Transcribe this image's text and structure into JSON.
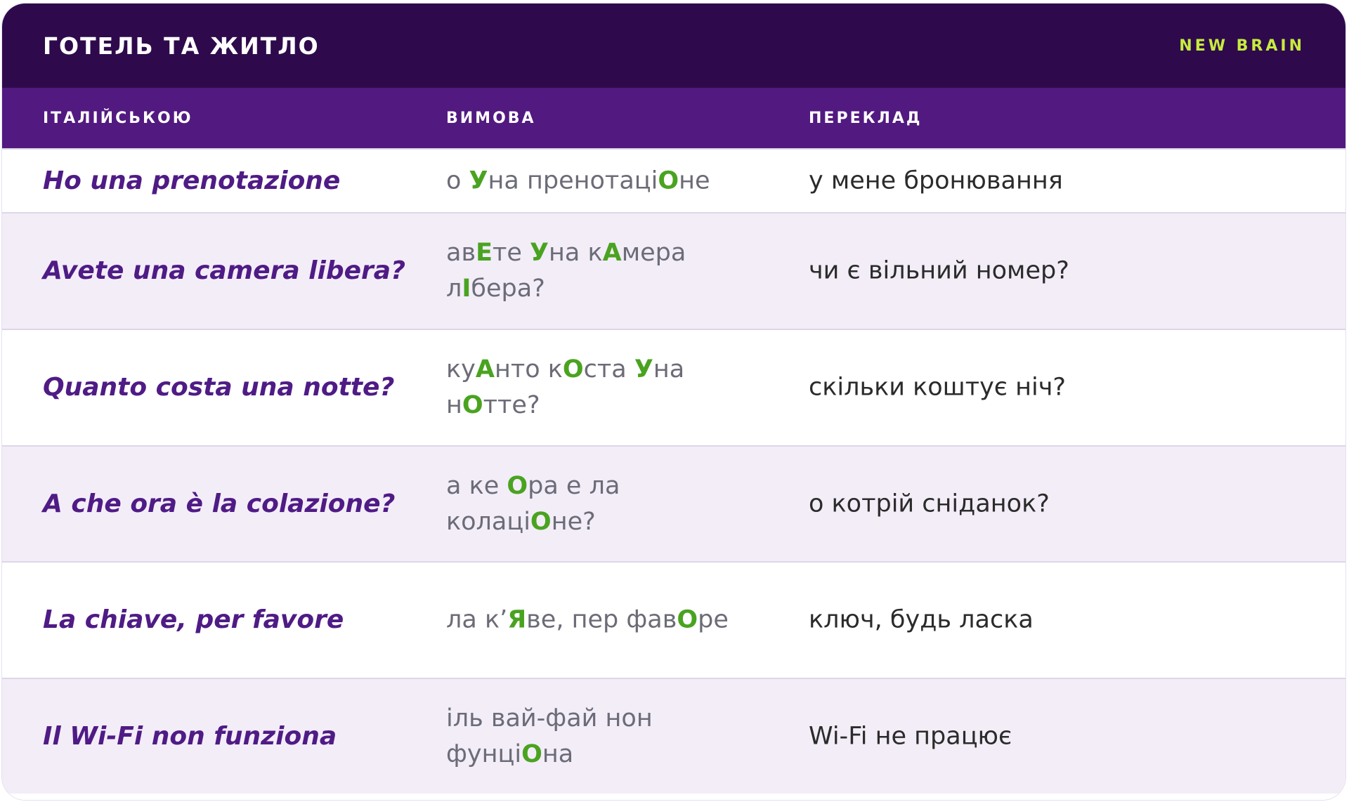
{
  "header": {
    "title": "ГОТЕЛЬ ТА ЖИТЛО",
    "brand": "NEW BRAIN"
  },
  "columns": {
    "italian": "ІТАЛІЙСЬКОЮ",
    "pronunciation": "ВИМОВА",
    "translation": "ПЕРЕКЛАД"
  },
  "rows": [
    {
      "italian": "Ho una prenotazione",
      "pronunciation": [
        {
          "text": "о "
        },
        {
          "text": "У",
          "accent": true
        },
        {
          "text": "на пренотаці"
        },
        {
          "text": "О",
          "accent": true
        },
        {
          "text": "не"
        }
      ],
      "translation": "у мене бронювання"
    },
    {
      "italian": "Avete una camera libera?",
      "pronunciation": [
        {
          "text": "ав"
        },
        {
          "text": "Е",
          "accent": true
        },
        {
          "text": "те "
        },
        {
          "text": "У",
          "accent": true
        },
        {
          "text": "на к"
        },
        {
          "text": "А",
          "accent": true
        },
        {
          "text": "мера л"
        },
        {
          "text": "І",
          "accent": true
        },
        {
          "text": "бера?"
        }
      ],
      "translation": "чи є вільний номер?"
    },
    {
      "italian": "Quanto costa una notte?",
      "pronunciation": [
        {
          "text": "ку"
        },
        {
          "text": "А",
          "accent": true
        },
        {
          "text": "нто к"
        },
        {
          "text": "О",
          "accent": true
        },
        {
          "text": "ста "
        },
        {
          "text": "У",
          "accent": true
        },
        {
          "text": "на н"
        },
        {
          "text": "О",
          "accent": true
        },
        {
          "text": "тте?"
        }
      ],
      "translation": "скільки коштує ніч?"
    },
    {
      "italian": "A che ora è la colazione?",
      "pronunciation": [
        {
          "text": "а ке "
        },
        {
          "text": "О",
          "accent": true
        },
        {
          "text": "ра е ла колаці"
        },
        {
          "text": "О",
          "accent": true
        },
        {
          "text": "не?"
        }
      ],
      "translation": "о котрій сніданок?"
    },
    {
      "italian": "La chiave, per favore",
      "pronunciation": [
        {
          "text": "ла к’"
        },
        {
          "text": "Я",
          "accent": true
        },
        {
          "text": "ве, пер фав"
        },
        {
          "text": "О",
          "accent": true
        },
        {
          "text": "ре"
        }
      ],
      "translation": "ключ, будь ласка"
    },
    {
      "italian": "Il Wi-Fi non funziona",
      "pronunciation": [
        {
          "text": "іль вай-фай нон фунці"
        },
        {
          "text": "О",
          "accent": true
        },
        {
          "text": "на"
        }
      ],
      "translation": "Wi-Fi не працює"
    }
  ]
}
